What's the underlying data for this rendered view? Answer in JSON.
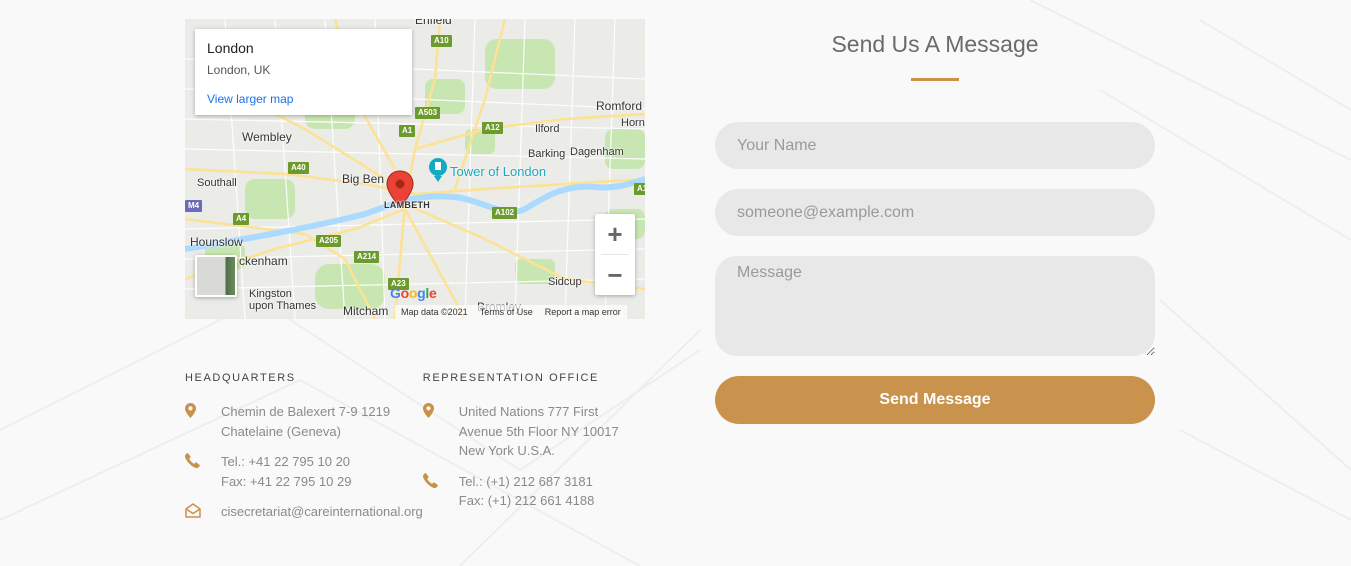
{
  "map": {
    "card": {
      "title": "London",
      "subtitle": "London, UK",
      "link": "View larger map"
    },
    "labels": {
      "enfield": "Enfield",
      "wembley": "Wembley",
      "romford": "Romford",
      "hornchurch": "Horn",
      "ilford": "Ilford",
      "barking": "Barking",
      "dagenham": "Dagenham",
      "southall": "Southall",
      "big_ben": "Big Ben",
      "tower": "Tower of London",
      "lambeth": "LAMBETH",
      "hounslow": "Hounslow",
      "twickenham": "ckenham",
      "kingston": "Kingston\nupon Thames",
      "sidcup": "Sidcup",
      "mitcham": "Mitcham",
      "bromley": "Bromley"
    },
    "roads": {
      "a10": "A10",
      "a503": "A503",
      "a1": "A1",
      "a12": "A12",
      "a40": "A40",
      "a4": "A4",
      "a205": "A205",
      "a214": "A214",
      "a23": "A23",
      "a102": "A102",
      "a2": "A2",
      "a1_right": "A1",
      "m4": "M4"
    },
    "zoom_in": "+",
    "zoom_out": "−",
    "footer": {
      "map_data": "Map data ©2021",
      "terms": "Terms of Use",
      "report": "Report a map error"
    },
    "google": [
      "G",
      "o",
      "o",
      "g",
      "l",
      "e"
    ],
    "colors": {
      "water": "#aadaff",
      "park": "#c8e6b1",
      "road": "#fde293",
      "marker": "#ea4335",
      "poi": "#15a9c4"
    }
  },
  "offices": [
    {
      "heading": "HEADQUARTERS",
      "address": [
        "Chemin de Balexert 7-9 1219",
        "Chatelaine (Geneva)"
      ],
      "phone": [
        "Tel.: +41 22 795 10 20",
        "Fax: +41 22 795 10 29"
      ],
      "email": "cisecretariat@careinternational.org"
    },
    {
      "heading": "REPRESENTATION OFFICE",
      "address": [
        "United Nations 777 First",
        "Avenue 5th Floor NY 10017",
        "New York U.S.A."
      ],
      "phone": [
        "Tel.: (+1) 212 687 3181",
        "Fax: (+1) 212 661 4188"
      ]
    }
  ],
  "icons": {
    "address": "map-pin-icon",
    "phone": "phone-icon",
    "email": "envelope-open-icon"
  },
  "form": {
    "title": "Send Us A Message",
    "name_placeholder": "Your Name",
    "email_placeholder": "someone@example.com",
    "message_placeholder": "Message",
    "submit_label": "Send Message",
    "accent": "#c9934d"
  }
}
